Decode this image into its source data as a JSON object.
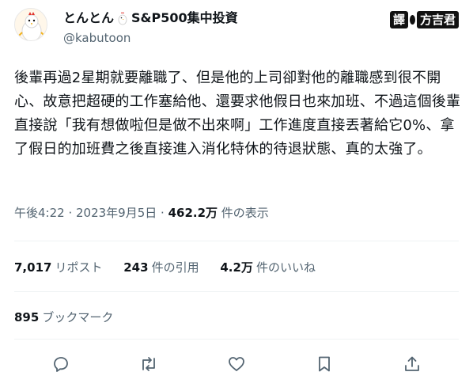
{
  "author": {
    "display_name": "とんとん",
    "display_name_suffix": "S&P500集中投資",
    "handle": "@kabutoon"
  },
  "watermark": {
    "left": "譯",
    "right": "方吉君"
  },
  "tweet": {
    "text": "後輩再過2星期就要離職了、但是他的上司卻對他的離職感到很不開心、故意把超硬的工作塞給他、還要求他假日也來加班、不過這個後輩直接說「我有想做啦但是做不出來啊」工作進度直接丟著給它0%、拿了假日的加班費之後直接進入消化特休的待退狀態、真的太強了。",
    "time": "午後4:22",
    "sep": " · ",
    "date": "2023年9月5日",
    "views": "462.2万",
    "views_label": " 件の表示"
  },
  "stats": {
    "reposts": "7,017",
    "reposts_label": "リポスト",
    "quotes": "243",
    "quotes_label": "件の引用",
    "likes": "4.2万",
    "likes_label": "件のいいね",
    "bookmarks": "895",
    "bookmarks_label": "ブックマーク"
  },
  "icons": {
    "reply": "reply-icon",
    "repost": "repost-icon",
    "like": "like-icon",
    "bookmark": "bookmark-icon",
    "share": "share-icon"
  },
  "colors": {
    "text": "#0f1419",
    "secondary": "#536471",
    "divider": "#eff3f4"
  }
}
